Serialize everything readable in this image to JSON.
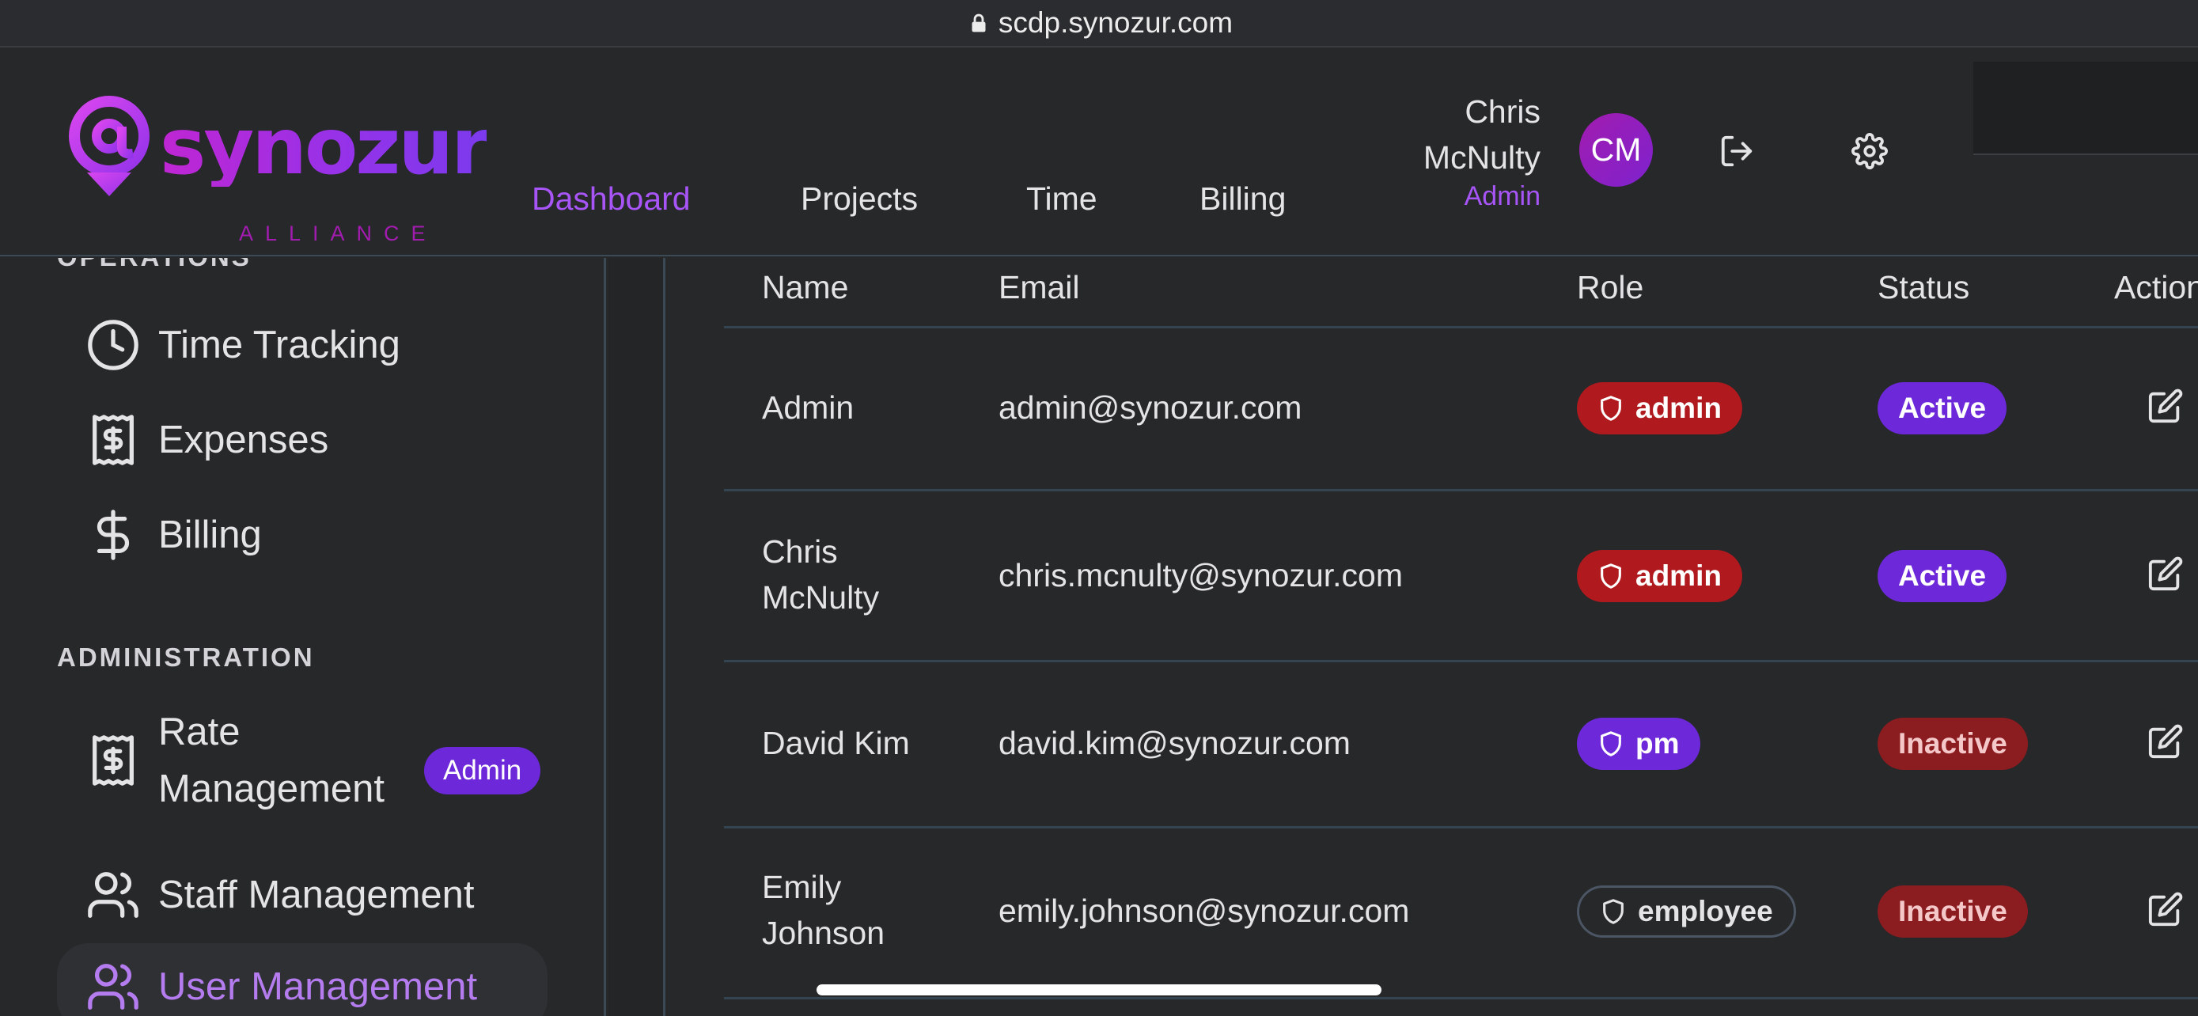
{
  "browser": {
    "url": "scdp.synozur.com"
  },
  "logo": {
    "brand": "synozur",
    "tagline": "ALLIANCE"
  },
  "nav": [
    {
      "label": "Dashboard",
      "active": true
    },
    {
      "label": "Projects",
      "active": false
    },
    {
      "label": "Time",
      "active": false
    },
    {
      "label": "Billing",
      "active": false
    }
  ],
  "user": {
    "first": "Chris",
    "last": "McNulty",
    "role": "Admin",
    "initials": "CM"
  },
  "sidebar": {
    "operations_title": "OPERATIONS",
    "operations": [
      {
        "label": "Time Tracking",
        "icon": "clock-icon"
      },
      {
        "label": "Expenses",
        "icon": "receipt-icon"
      },
      {
        "label": "Billing",
        "icon": "dollar-icon"
      }
    ],
    "administration_title": "ADMINISTRATION",
    "administration": [
      {
        "label_line1": "Rate",
        "label_line2": "Management",
        "icon": "receipt-icon",
        "badge": "Admin"
      },
      {
        "label": "Staff Management",
        "icon": "users-icon"
      },
      {
        "label": "User Management",
        "icon": "users-icon",
        "selected": true
      }
    ]
  },
  "table": {
    "headers": {
      "name": "Name",
      "email": "Email",
      "role": "Role",
      "status": "Status",
      "actions": "Actions"
    },
    "rows": [
      {
        "name_line1": "Admin",
        "name_line2": "",
        "email": "admin@synozur.com",
        "role": "admin",
        "status": "Active"
      },
      {
        "name_line1": "Chris",
        "name_line2": "McNulty",
        "email": "chris.mcnulty@synozur.com",
        "role": "admin",
        "status": "Active"
      },
      {
        "name_line1": "David Kim",
        "name_line2": "",
        "email": "david.kim@synozur.com",
        "role": "pm",
        "status": "Inactive"
      },
      {
        "name_line1": "Emily",
        "name_line2": "Johnson",
        "email": "emily.johnson@synozur.com",
        "role": "employee",
        "status": "Inactive"
      }
    ]
  },
  "colors": {
    "accent": "#a855f7",
    "admin_role": "#b0191e",
    "pm_role": "#6d28d9",
    "active_status": "#6d28d9",
    "inactive_status": "#8b1c20"
  }
}
